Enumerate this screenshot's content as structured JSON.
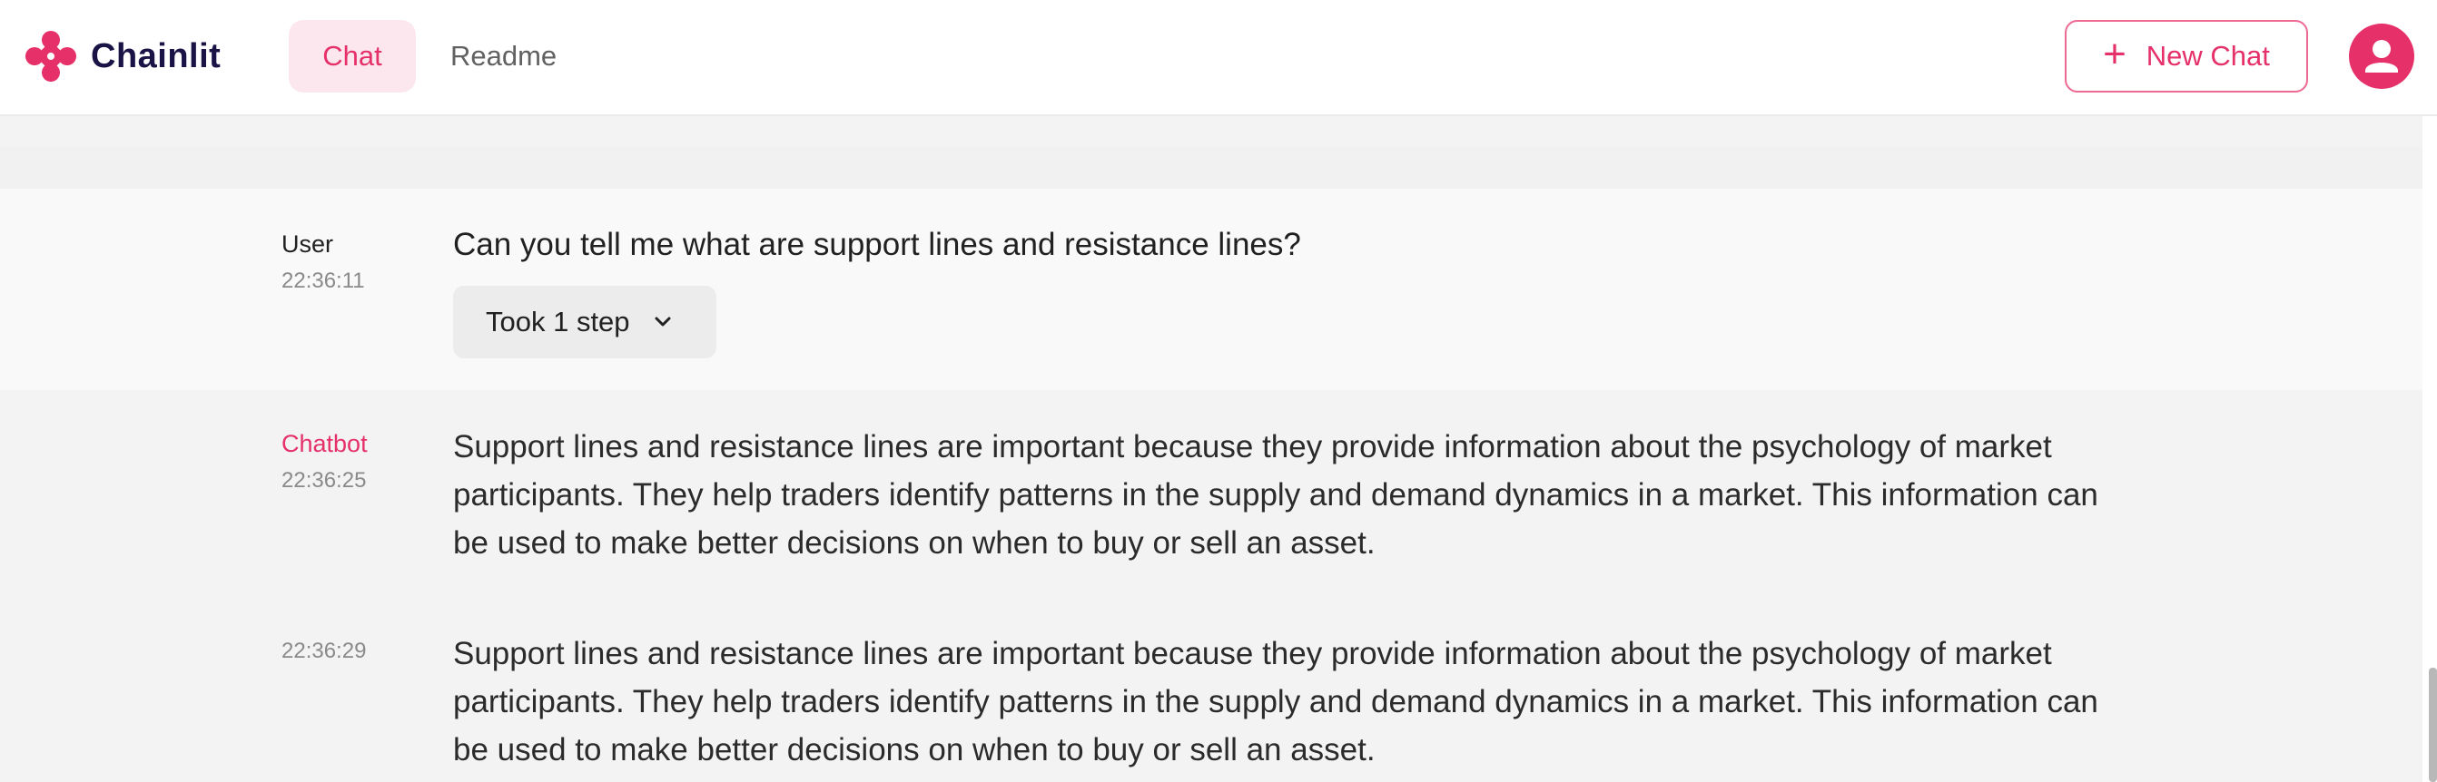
{
  "app": {
    "name": "Chainlit",
    "brand_color": "#e5306a",
    "logo_text_color": "#1a1446"
  },
  "header": {
    "tabs": [
      {
        "label": "Chat",
        "active": true
      },
      {
        "label": "Readme",
        "active": false
      }
    ],
    "new_chat_label": "New Chat",
    "icons": {
      "new_chat": "plus-icon",
      "user": "user-avatar-icon"
    }
  },
  "messages": [
    {
      "author": "User",
      "time": "22:36:11",
      "text": "Can you tell me what are support lines and resistance lines?",
      "steps_label": "Took 1 step"
    },
    {
      "author": "Chatbot",
      "time": "22:36:25",
      "text": "Support lines and resistance lines are important because they provide information about the psychology of market participants. They help traders identify patterns in the supply and demand dynamics in a market. This information can be used to make better decisions on when to buy or sell an asset."
    },
    {
      "author": "",
      "time": "22:36:29",
      "text": "Support lines and resistance lines are important because they provide information about the psychology of market participants. They help traders identify patterns in the supply and demand dynamics in a market. This information can be used to make better decisions on when to buy or sell an asset."
    }
  ]
}
